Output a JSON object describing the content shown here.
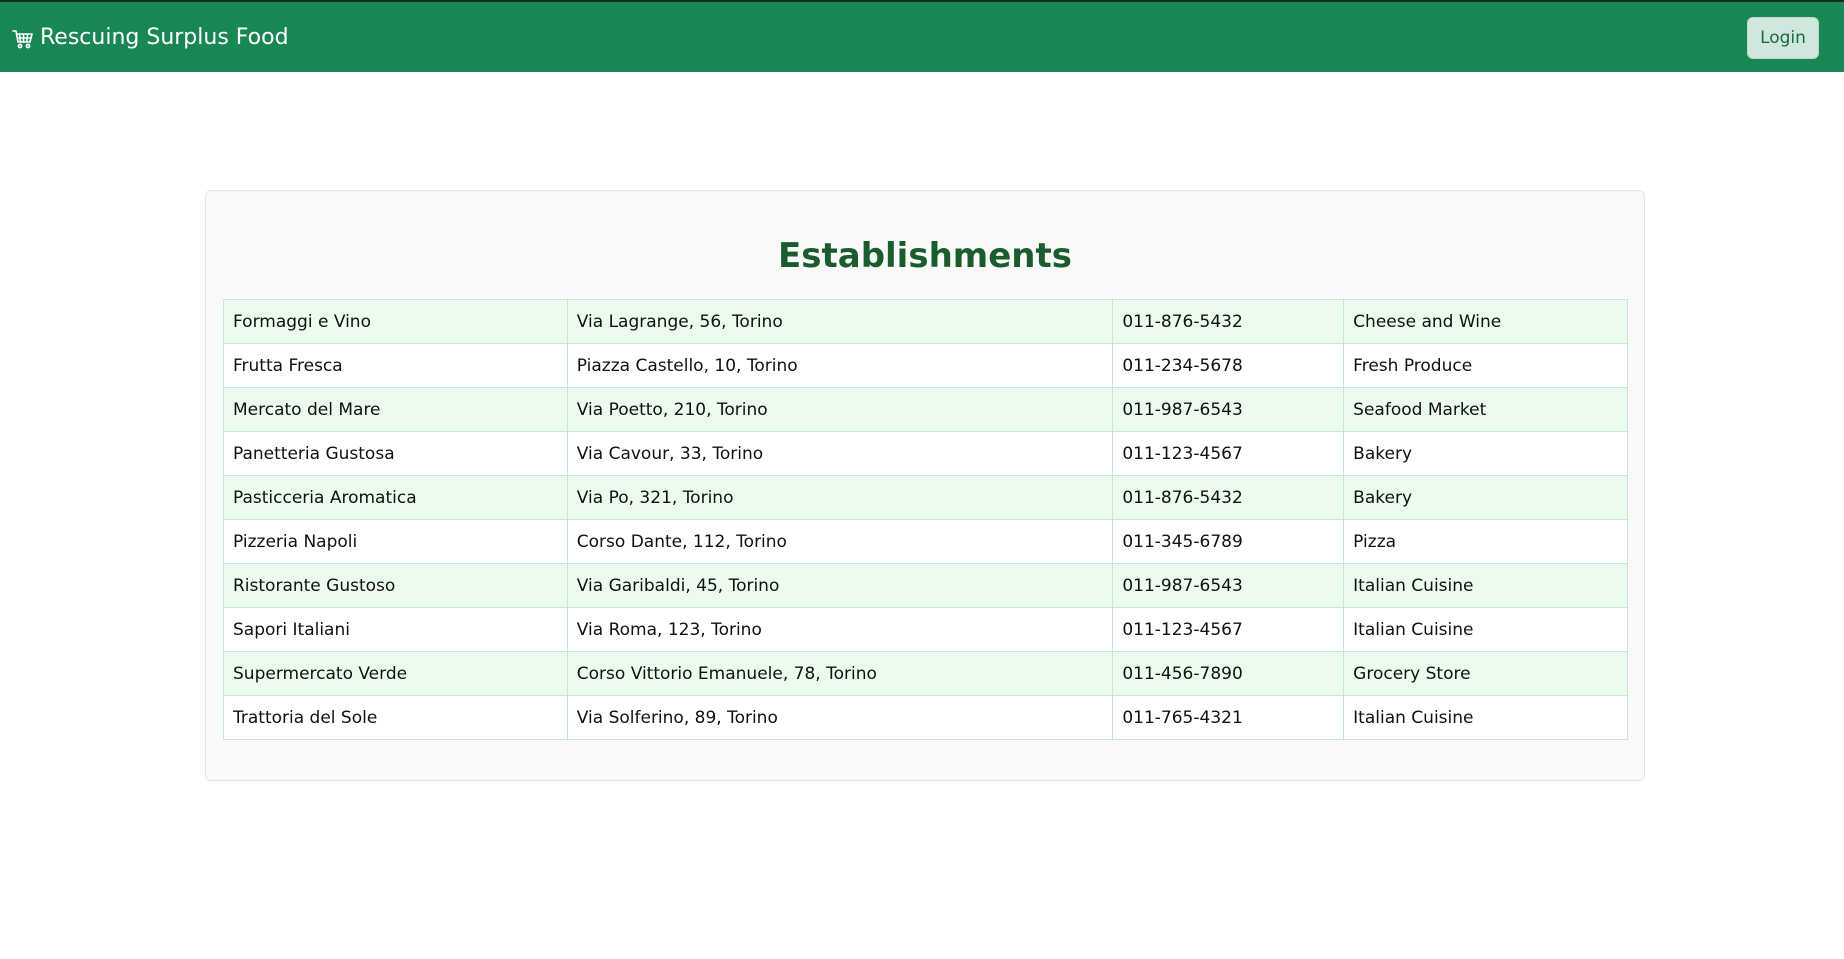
{
  "navbar": {
    "brand": "Rescuing Surplus Food",
    "brand_icon": "cart-icon",
    "login_label": "Login",
    "background": "#198754"
  },
  "main": {
    "title": "Establishments",
    "rows": [
      {
        "name": "Formaggi e Vino",
        "address": "Via Lagrange, 56, Torino",
        "phone": "011-876-5432",
        "category": "Cheese and Wine"
      },
      {
        "name": "Frutta Fresca",
        "address": "Piazza Castello, 10, Torino",
        "phone": "011-234-5678",
        "category": "Fresh Produce"
      },
      {
        "name": "Mercato del Mare",
        "address": "Via Poetto, 210, Torino",
        "phone": "011-987-6543",
        "category": "Seafood Market"
      },
      {
        "name": "Panetteria Gustosa",
        "address": "Via Cavour, 33, Torino",
        "phone": "011-123-4567",
        "category": "Bakery"
      },
      {
        "name": "Pasticceria Aromatica",
        "address": "Via Po, 321, Torino",
        "phone": "011-876-5432",
        "category": "Bakery"
      },
      {
        "name": "Pizzeria Napoli",
        "address": "Corso Dante, 112, Torino",
        "phone": "011-345-6789",
        "category": "Pizza"
      },
      {
        "name": "Ristorante Gustoso",
        "address": "Via Garibaldi, 45, Torino",
        "phone": "011-987-6543",
        "category": "Italian Cuisine"
      },
      {
        "name": "Sapori Italiani",
        "address": "Via Roma, 123, Torino",
        "phone": "011-123-4567",
        "category": "Italian Cuisine"
      },
      {
        "name": "Supermercato Verde",
        "address": "Corso Vittorio Emanuele, 78, Torino",
        "phone": "011-456-7890",
        "category": "Grocery Store"
      },
      {
        "name": "Trattoria del Sole",
        "address": "Via Solferino, 89, Torino",
        "phone": "011-765-4321",
        "category": "Italian Cuisine"
      }
    ]
  }
}
